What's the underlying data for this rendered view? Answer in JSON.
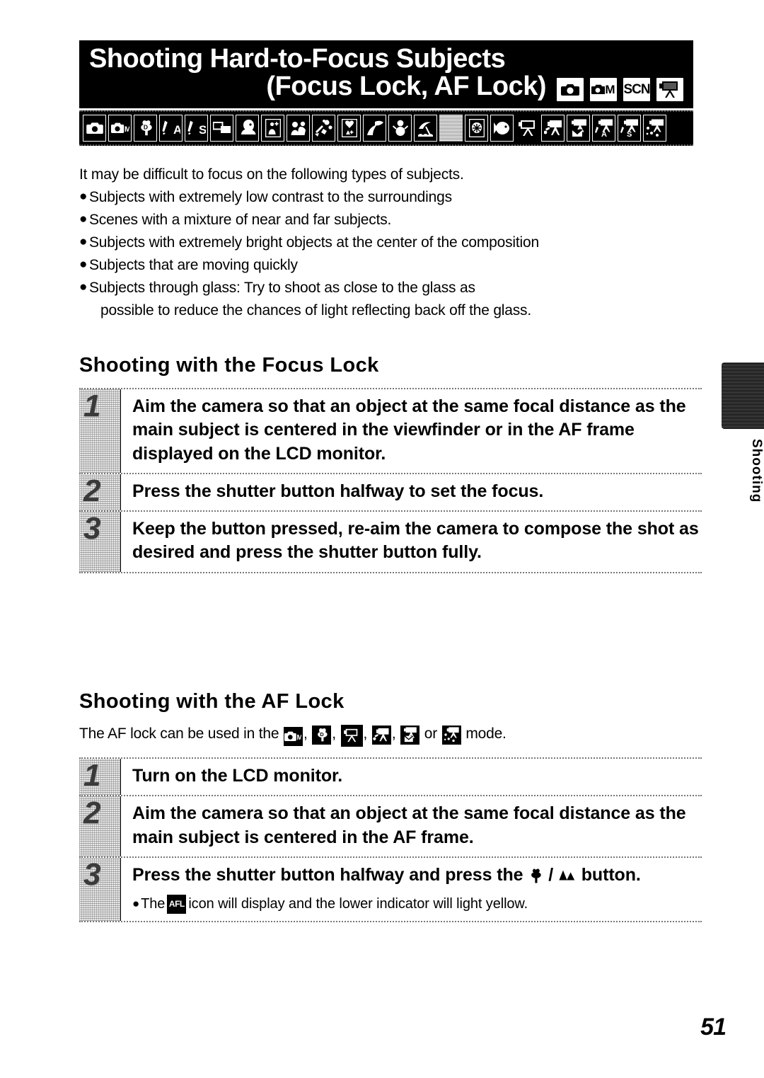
{
  "header": {
    "title_line1": "Shooting Hard-to-Focus Subjects",
    "title_line2": "(Focus Lock, AF Lock)",
    "mode_badges": [
      {
        "name": "auto-mode-badge",
        "label": "",
        "icon": "camera-icon"
      },
      {
        "name": "manual-mode-badge",
        "label": "M",
        "icon": "camera-m-icon"
      },
      {
        "name": "scene-mode-badge",
        "label": "SCN",
        "icon": "scn-text-icon"
      },
      {
        "name": "movie-mode-badge",
        "label": "",
        "icon": "movie-camera-icon"
      }
    ],
    "icon_strip": [
      {
        "name": "auto-icon",
        "style": "boxed",
        "glyph": "camera"
      },
      {
        "name": "manual-icon",
        "style": "boxed",
        "glyph": "camera-m"
      },
      {
        "name": "digital-macro-icon",
        "style": "boxed",
        "glyph": "tulip-d"
      },
      {
        "name": "aperture-priority-icon",
        "style": "boxed",
        "glyph": "brush-a"
      },
      {
        "name": "shutter-priority-icon",
        "style": "boxed",
        "glyph": "brush-s"
      },
      {
        "name": "stitch-assist-icon",
        "style": "boxed",
        "glyph": "stitch"
      },
      {
        "name": "portrait-icon",
        "style": "boxed",
        "glyph": "portrait"
      },
      {
        "name": "night-snapshot-icon",
        "style": "boxed",
        "glyph": "night-person"
      },
      {
        "name": "kids-and-pets-icon",
        "style": "boxed",
        "glyph": "kids-pets"
      },
      {
        "name": "indoor-icon",
        "style": "boxed",
        "glyph": "indoor"
      },
      {
        "name": "night-scene-icon",
        "style": "boxed",
        "glyph": "night-scene"
      },
      {
        "name": "foliage-icon",
        "style": "boxed",
        "glyph": "foliage"
      },
      {
        "name": "snow-icon",
        "style": "boxed",
        "glyph": "snowman"
      },
      {
        "name": "beach-icon",
        "style": "boxed",
        "glyph": "beach"
      },
      {
        "name": "separator-icon",
        "style": "dither",
        "glyph": ""
      },
      {
        "name": "fireworks-icon",
        "style": "boxed",
        "glyph": "fireworks"
      },
      {
        "name": "underwater-icon",
        "style": "boxed",
        "glyph": "fish"
      },
      {
        "name": "movie-standard-icon",
        "style": "frame",
        "glyph": "movie"
      },
      {
        "name": "movie-fast-icon",
        "style": "boxed",
        "glyph": "movie-fast"
      },
      {
        "name": "movie-compact-icon",
        "style": "boxed",
        "glyph": "movie-mail"
      },
      {
        "name": "movie-aperture-icon",
        "style": "boxed",
        "glyph": "movie-a"
      },
      {
        "name": "movie-shutter-icon",
        "style": "boxed",
        "glyph": "movie-s"
      },
      {
        "name": "movie-color-icon",
        "style": "boxed",
        "glyph": "movie-color"
      }
    ]
  },
  "intro": {
    "lead": "It may be difficult to focus on the following types of subjects.",
    "bullets": [
      "Subjects with extremely low contrast to the surroundings",
      "Scenes with a mixture of near and far subjects.",
      "Subjects with extremely bright objects at the center of the composition",
      "Subjects that are moving quickly",
      "Subjects through glass: Try to shoot as close to the glass as"
    ],
    "last_bullet_continuation": "possible to reduce the chances of light reflecting back off the glass."
  },
  "focus_lock": {
    "heading": "Shooting with the Focus Lock",
    "steps": [
      {
        "number": "1",
        "text": "Aim the camera so that an object at the same focal distance as the main subject is centered in the viewfinder or in the AF frame displayed on the LCD monitor."
      },
      {
        "number": "2",
        "text": "Press the shutter button halfway to set the focus."
      },
      {
        "number": "3",
        "text": "Keep the button pressed, re-aim the camera to compose the shot as desired and press the shutter button fully."
      }
    ]
  },
  "af_lock": {
    "heading": "Shooting with the AF Lock",
    "intro_prefix": "The AF lock can be used in the",
    "intro_or": "or",
    "intro_suffix": "mode.",
    "intro_icons": [
      {
        "name": "manual-mode-icon",
        "glyph": "camera-m"
      },
      {
        "name": "digital-macro-mode-icon",
        "glyph": "tulip-d"
      },
      {
        "name": "movie-standard-mode-icon",
        "glyph": "movie"
      },
      {
        "name": "movie-fast-mode-icon",
        "glyph": "movie-fast"
      },
      {
        "name": "movie-compact-mode-icon",
        "glyph": "movie-mail"
      },
      {
        "name": "movie-color-mode-icon",
        "glyph": "movie-color"
      }
    ],
    "steps": [
      {
        "number": "1",
        "text": "Turn on the LCD monitor."
      },
      {
        "number": "2",
        "text": "Aim the camera so that an object at the same focal distance as the main subject is centered in the AF frame."
      },
      {
        "number": "3",
        "text_before": "Press the shutter button halfway and press the",
        "text_after": "button."
      }
    ],
    "note_prefix": "The",
    "note_icon_label": "AFL",
    "note_suffix": "icon will display and the lower indicator will light yellow."
  },
  "side_tab": {
    "label": "Shooting"
  },
  "page_number": "51"
}
